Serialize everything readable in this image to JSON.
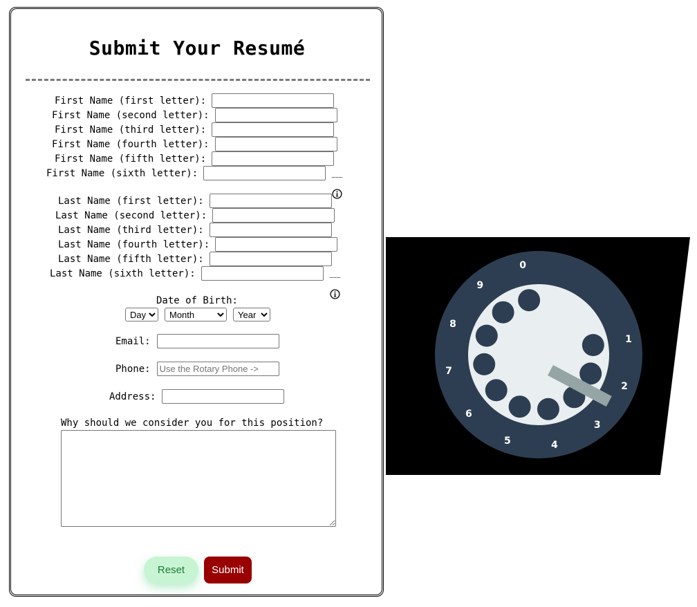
{
  "form": {
    "title": "Submit Your Resumé",
    "first_name_fields": [
      {
        "label": "First Name (first letter):"
      },
      {
        "label": "First Name (second letter):"
      },
      {
        "label": "First Name (third letter):"
      },
      {
        "label": "First Name (fourth letter):"
      },
      {
        "label": "First Name (fifth letter):"
      },
      {
        "label": "First Name (sixth letter):"
      }
    ],
    "last_name_fields": [
      {
        "label": "Last Name (first letter):"
      },
      {
        "label": "Last Name (second letter):"
      },
      {
        "label": "Last Name (third letter):"
      },
      {
        "label": "Last Name (fourth letter):"
      },
      {
        "label": "Last Name (fifth letter):"
      },
      {
        "label": "Last Name (sixth letter):"
      }
    ],
    "dob": {
      "label": "Date of Birth:",
      "day": "Day",
      "month": "Month",
      "year": "Year"
    },
    "email_label": "Email:",
    "phone_label": "Phone:",
    "phone_placeholder": "Use the Rotary Phone ->",
    "address_label": "Address:",
    "why_label": "Why should we consider you for this position?",
    "reset_label": "Reset",
    "submit_label": "Submit",
    "info_icon": "info-circle-icon"
  },
  "rotary_phone": {
    "digits": [
      "1",
      "2",
      "3",
      "4",
      "5",
      "6",
      "7",
      "8",
      "9",
      "0"
    ],
    "colors": {
      "panel": "#000000",
      "dial": "#2e3e52",
      "face": "#e9eef0",
      "hole": "#2e3e52",
      "digit": "#ffffff",
      "stop": "#95a5a6"
    }
  }
}
